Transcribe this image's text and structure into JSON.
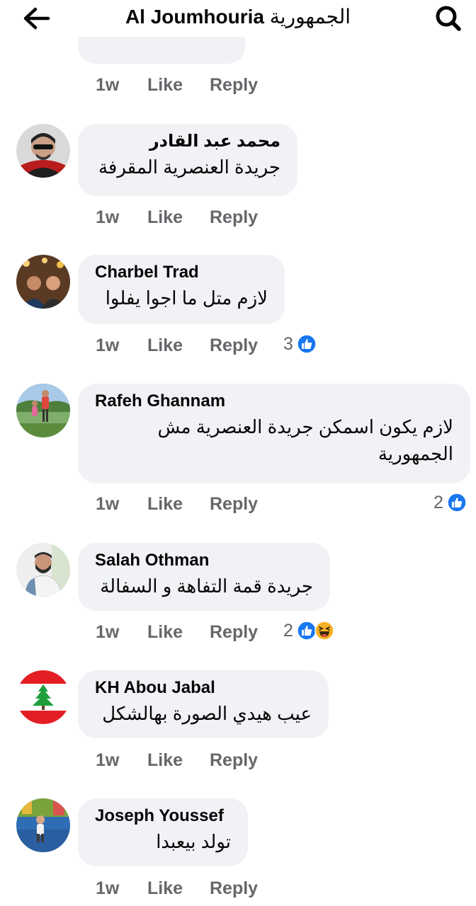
{
  "header": {
    "title_en": "Al Joumhouria",
    "title_ar": "الجمهورية",
    "back_icon": "back-arrow-icon",
    "search_icon": "search-icon"
  },
  "first_actions": {
    "time": "1w",
    "like": "Like",
    "reply": "Reply"
  },
  "comments": [
    {
      "author": "محمد عبد القادر",
      "text": "جريدة العنصرية المقرفة",
      "time": "1w",
      "like": "Like",
      "reply": "Reply",
      "reaction_count": "",
      "reactions": []
    },
    {
      "author": "Charbel Trad",
      "text": "لازم متل ما اجوا يفلوا",
      "time": "1w",
      "like": "Like",
      "reply": "Reply",
      "reaction_count": "3",
      "reactions": [
        "like-reaction-icon"
      ]
    },
    {
      "author": "Rafeh Ghannam",
      "text_line1": "لازم يكون اسمكن جريدة العنصرية مش",
      "text_line2": "الجمهورية",
      "time": "1w",
      "like": "Like",
      "reply": "Reply",
      "reaction_count": "2",
      "reactions": [
        "like-reaction-icon"
      ]
    },
    {
      "author": "Salah Othman",
      "text": "جريدة قمة التفاهة و السفالة",
      "time": "1w",
      "like": "Like",
      "reply": "Reply",
      "reaction_count": "2",
      "reactions": [
        "like-reaction-icon",
        "haha-reaction-icon"
      ]
    },
    {
      "author": "KH Abou Jabal",
      "text": "عيب هيدي الصورة بهالشكل",
      "time": "1w",
      "like": "Like",
      "reply": "Reply",
      "reaction_count": "",
      "reactions": []
    },
    {
      "author": "Joseph Youssef",
      "text": "تولد بيعبدا",
      "time": "1w",
      "like": "Like",
      "reply": "Reply",
      "reaction_count": "",
      "reactions": []
    }
  ],
  "colors": {
    "bubble": "#f0f2f5",
    "meta_text": "#65676b",
    "like_blue": "#1877f2",
    "haha_yellow": "#f7b125"
  }
}
